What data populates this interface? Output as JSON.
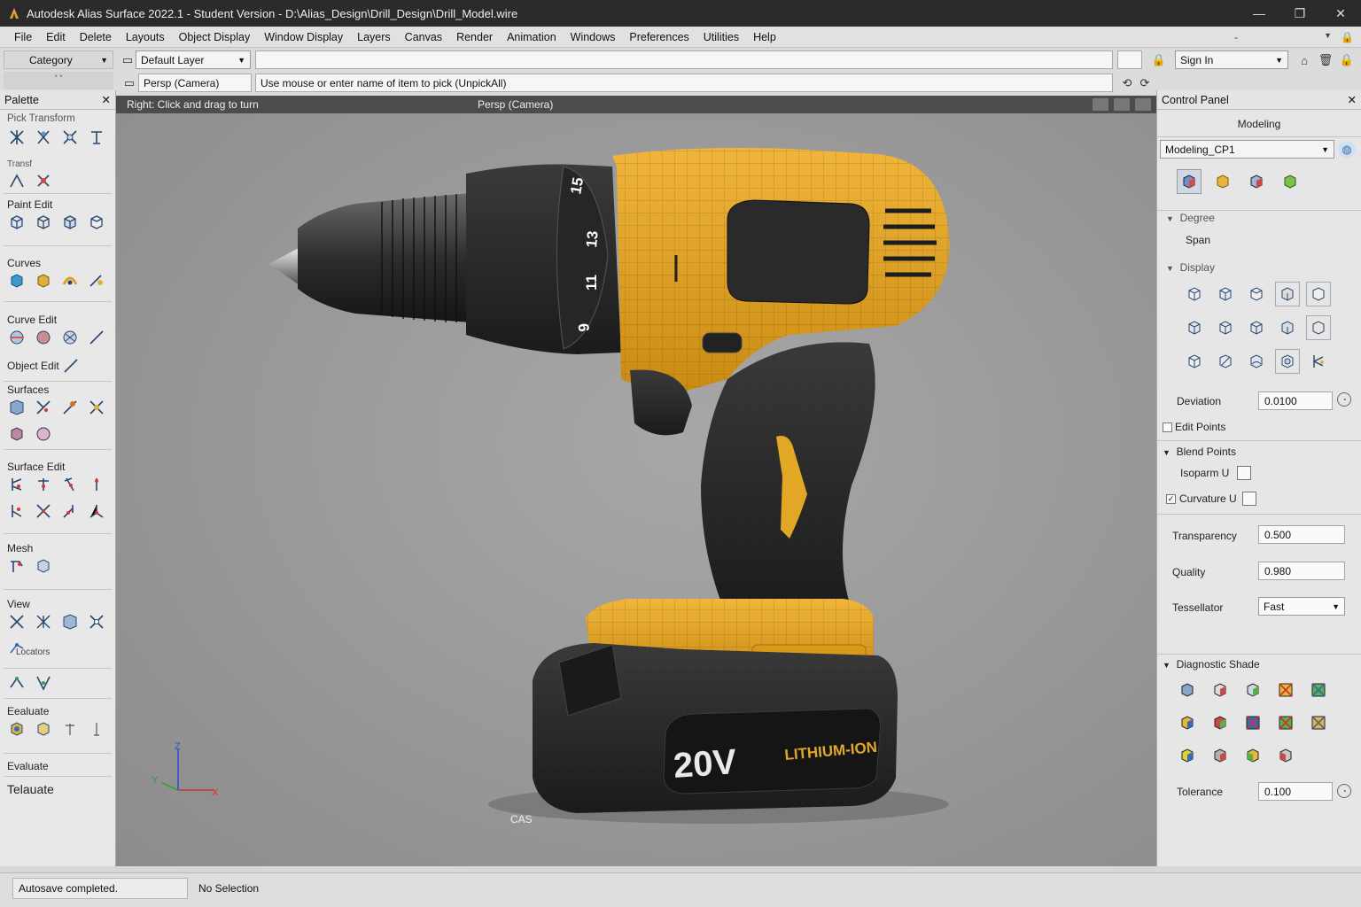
{
  "window": {
    "title": "Autodesk Alias Surface 2022.1 - Student Version - D:\\Alias_Design\\Drill_Design\\Drill_Model.wire",
    "minimize": "—",
    "maximize": "❐",
    "close": "✕"
  },
  "menu": [
    "File",
    "Edit",
    "Delete",
    "Layouts",
    "Object Display",
    "Window Display",
    "Layers",
    "Canvas",
    "Render",
    "Animation",
    "Windows",
    "Preferences",
    "Utilities",
    "Help"
  ],
  "toolbar": {
    "category": "Category",
    "layer": "Default Layer",
    "signin": "Sign In",
    "camera": "Persp (Camera)",
    "prompt": "Use mouse or enter name of item to pick (UnpickAll)"
  },
  "palette": {
    "title": "Palette",
    "close": "✕",
    "tabs": "Pick  Transform",
    "sections": [
      "Transf",
      "Paint Edit",
      "Curves",
      "Curve Edit",
      "Object Edit",
      "Surfaces",
      "Surface Edit",
      "Mesh",
      "View",
      "Locators",
      "Eealuate",
      "Evaluate",
      "Telauate"
    ]
  },
  "viewport": {
    "hint": "Right: Click and drag to turn",
    "camera": "Persp (Camera)",
    "cas": "CAS",
    "axis": {
      "z": "Z",
      "y": "Y",
      "x": "X"
    },
    "product": {
      "voltage": "20V",
      "battery": "LITHIUM-ION",
      "dial": [
        "15",
        "13",
        "11",
        "9"
      ]
    }
  },
  "control_panel": {
    "title": "Control Panel",
    "close": "✕",
    "mode": "Modeling",
    "preset": "Modeling_CP1",
    "degree": "Degree",
    "span": "Span",
    "display": "Display",
    "deviation_label": "Deviation",
    "deviation": "0.0100",
    "edit_points": "Edit Points",
    "blend_points": "Blend Points",
    "isoparm": "Isoparm U",
    "curvature": "Curvature U",
    "curvature_checked": "✓",
    "transparency_label": "Transparency",
    "transparency": "0.500",
    "quality_label": "Quality",
    "quality": "0.980",
    "tessellator_label": "Tessellator",
    "tessellator": "Fast",
    "diag": "Diagnostic Shade",
    "tolerance_label": "Tolerance",
    "tolerance": "0.100"
  },
  "status": {
    "left": "Autosave completed.",
    "right": "No Selection"
  }
}
